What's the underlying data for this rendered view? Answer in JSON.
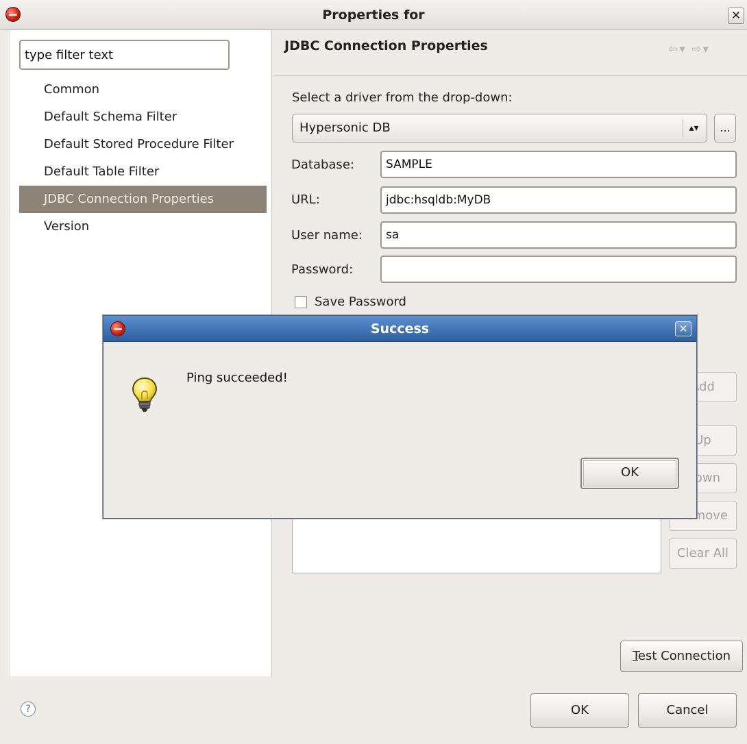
{
  "window": {
    "title": "Properties for"
  },
  "filter": {
    "value": "type filter text"
  },
  "nav": {
    "items": [
      {
        "label": "Common"
      },
      {
        "label": "Default Schema Filter"
      },
      {
        "label": "Default Stored Procedure Filter"
      },
      {
        "label": "Default Table Filter"
      },
      {
        "label": "JDBC Connection Properties",
        "selected": true
      },
      {
        "label": "Version"
      }
    ]
  },
  "page": {
    "title": "JDBC Connection Properties",
    "driver_prompt": "Select a driver from the drop-down:",
    "driver_selected": "Hypersonic DB",
    "browse_label": "...",
    "database_label": "Database:",
    "database_value": "SAMPLE",
    "url_label": "URL:",
    "url_value": "jdbc:hsqldb:MyDB",
    "user_label": "User name:",
    "user_value": "sa",
    "password_label": "Password:",
    "password_value": "",
    "save_password_label": "Save Password",
    "save_password_checked": false,
    "side_buttons": {
      "add": "Add",
      "up": "Up",
      "down": "Down",
      "remove": "Remove",
      "clear_all": "Clear All"
    },
    "test_connection_label": "Test Connection"
  },
  "footer": {
    "ok_label": "OK",
    "cancel_label": "Cancel"
  },
  "dialog": {
    "title": "Success",
    "message": "Ping succeeded!",
    "ok_label": "OK"
  },
  "icons": {
    "app": "app-icon",
    "close": "close-icon",
    "info": "lightbulb-icon",
    "help": "help-icon",
    "back": "back-arrow-icon",
    "forward": "forward-arrow-icon"
  },
  "colors": {
    "selected_nav_bg": "#8d8377",
    "dialog_titlebar": "#3f72b5",
    "window_bg": "#efebe7"
  }
}
